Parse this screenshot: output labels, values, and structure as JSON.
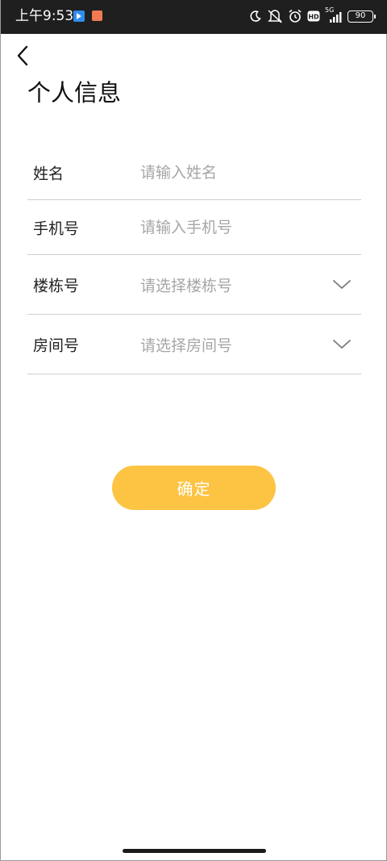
{
  "status_bar": {
    "time": "上午9:53",
    "network": "5G",
    "battery": "90",
    "icons": [
      "moon-icon",
      "mute-icon",
      "alarm-icon",
      "hd-icon",
      "signal-icon",
      "battery-icon"
    ],
    "colors": {
      "background": "#1f1f1f",
      "foreground": "#ffffff"
    }
  },
  "header": {
    "back_icon": "chevron-left-icon",
    "title": "个人信息"
  },
  "form": {
    "rows": [
      {
        "label": "姓名",
        "placeholder": "请输入姓名",
        "type": "input"
      },
      {
        "label": "手机号",
        "placeholder": "请输入手机号",
        "type": "input"
      },
      {
        "label": "楼栋号",
        "placeholder": "请选择楼栋号",
        "type": "select",
        "icon": "chevron-down-icon"
      },
      {
        "label": "房间号",
        "placeholder": "请选择房间号",
        "type": "select",
        "icon": "chevron-down-icon"
      }
    ]
  },
  "actions": {
    "confirm_label": "确定"
  },
  "colors": {
    "accent": "#fdc343",
    "placeholder": "#a6a6a6",
    "divider": "#cfcfcf",
    "text": "#222222"
  }
}
